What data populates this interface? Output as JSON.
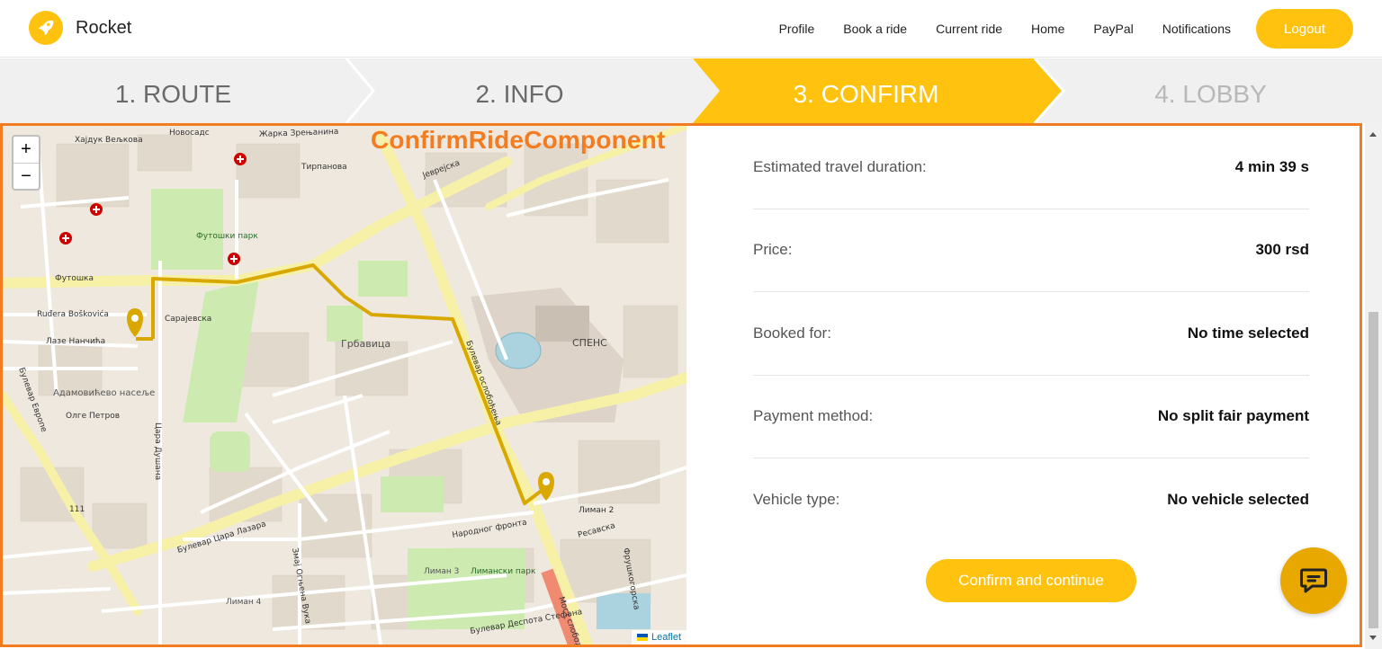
{
  "app": {
    "name": "Rocket"
  },
  "nav": {
    "links": [
      "Profile",
      "Book a ride",
      "Current ride",
      "Home",
      "PayPal",
      "Notifications"
    ],
    "logout_label": "Logout"
  },
  "stepper": {
    "steps": [
      {
        "label": "1. ROUTE",
        "state": "done"
      },
      {
        "label": "2. INFO",
        "state": "done"
      },
      {
        "label": "3. CONFIRM",
        "state": "active"
      },
      {
        "label": "4. LOBBY",
        "state": "pending"
      }
    ]
  },
  "component_tag": "ConfirmRideComponent",
  "map": {
    "zoom_in": "+",
    "zoom_out": "−",
    "attribution": "Leaflet",
    "labels": [
      "Хајдук Вељкова",
      "Новосадс",
      "Жарка Зрењанина",
      "Тирпанова",
      "Јеврејска",
      "Футошки парк",
      "Футошка",
      "Ruđera Boškovića",
      "Сарајевска",
      "Лазе Нанчића",
      "Грбавица",
      "СПЕНС",
      "Адамовићево насеље",
      "Олге Петров",
      "Булевар Цара Лазара",
      "Лиман 2",
      "Лиман 3",
      "Лиманcки парк",
      "Лиман 4",
      "Народног фронта",
      "Булевар Европе",
      "Цара Душана",
      "Булевар ослобођења",
      "Мост слободе",
      "Булевар Деспота Стефана",
      "Ресавска",
      "Фрушкогорска",
      "Змај Огњена Вука",
      "111"
    ]
  },
  "details": [
    {
      "label": "Estimated travel duration:",
      "value": "4 min 39 s"
    },
    {
      "label": "Price:",
      "value": "300 rsd"
    },
    {
      "label": "Booked for:",
      "value": "No time selected"
    },
    {
      "label": "Payment method:",
      "value": "No split fair payment"
    },
    {
      "label": "Vehicle type:",
      "value": "No vehicle selected"
    }
  ],
  "confirm_label": "Confirm and continue",
  "colors": {
    "accent": "#ffc20e",
    "component_outline": "#f47c20",
    "route": "#d9a800"
  },
  "icons": {
    "brand": "rocket-icon",
    "chat": "chat-icon",
    "marker": "map-marker-icon",
    "hospital": "hospital-icon"
  }
}
